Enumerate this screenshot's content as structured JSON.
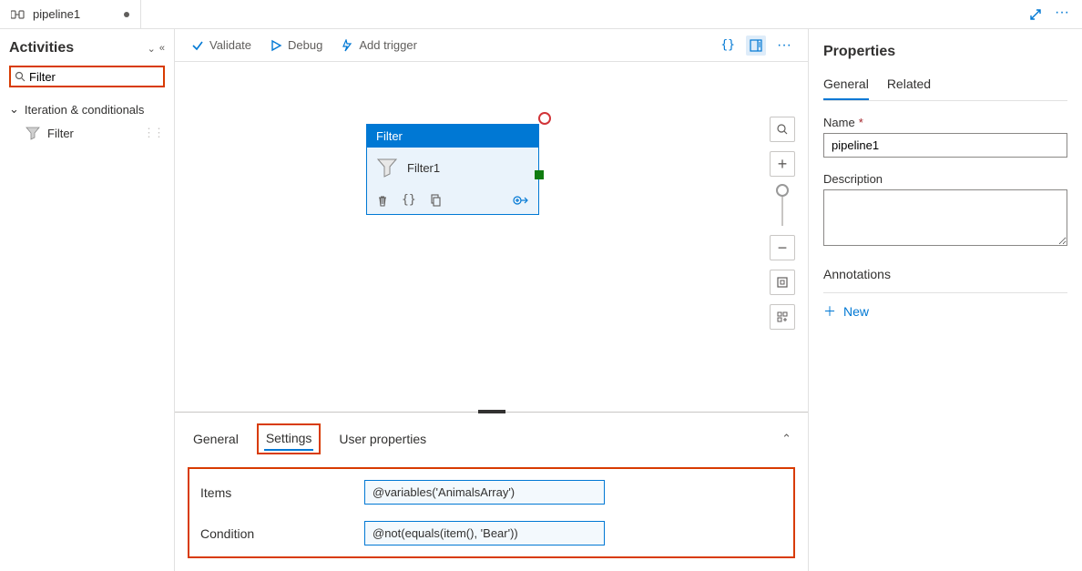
{
  "tab": {
    "title": "pipeline1"
  },
  "sidebar": {
    "title": "Activities",
    "search_value": "Filter",
    "category": "Iteration & conditionals",
    "activity": "Filter"
  },
  "toolbar": {
    "validate": "Validate",
    "debug": "Debug",
    "add_trigger": "Add trigger"
  },
  "node": {
    "type": "Filter",
    "name": "Filter1"
  },
  "bottom": {
    "tabs": {
      "general": "General",
      "settings": "Settings",
      "user_properties": "User properties"
    },
    "items_label": "Items",
    "items_value": "@variables('AnimalsArray')",
    "condition_label": "Condition",
    "condition_value": "@not(equals(item(), 'Bear'))"
  },
  "properties": {
    "title": "Properties",
    "tabs": {
      "general": "General",
      "related": "Related"
    },
    "name_label": "Name",
    "name_value": "pipeline1",
    "description_label": "Description",
    "description_value": "",
    "annotations_label": "Annotations",
    "new_label": "New"
  }
}
